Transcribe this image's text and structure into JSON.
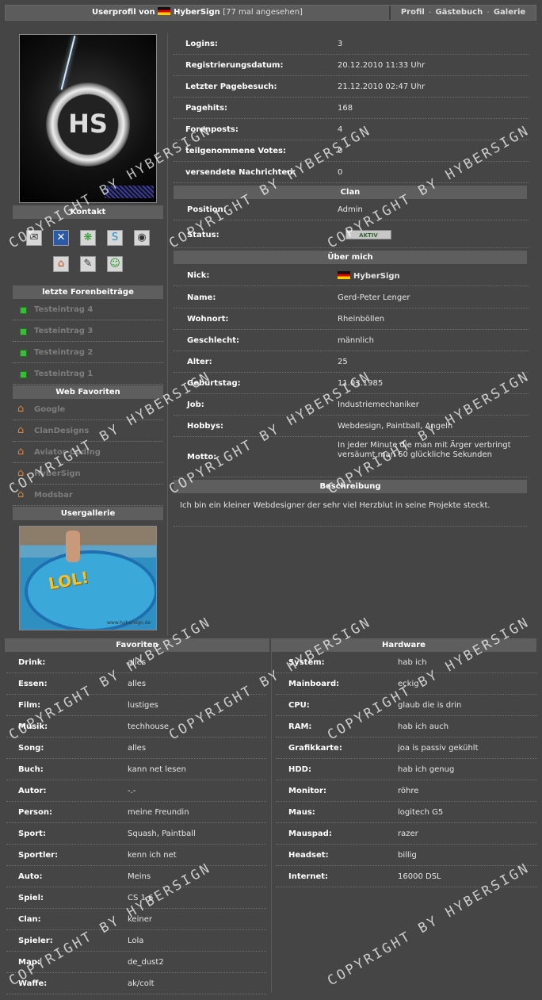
{
  "header": {
    "title_prefix": "Userprofil von",
    "username": "HyberSign",
    "views": "[77 mal angesehen]",
    "nav": [
      "Profil",
      "Gästebuch",
      "Galerie"
    ]
  },
  "sidebar": {
    "contact_title": "Kontakt",
    "contact_icons": [
      "mail-icon",
      "xfire-icon",
      "icq-icon",
      "skype-icon",
      "steam-icon",
      "homepage-icon",
      "guestbook-icon",
      "add-buddy-icon"
    ],
    "posts_title": "letzte Forenbeiträge",
    "posts": [
      "Testeintrag 4",
      "Testeintrag 3",
      "Testeintrag 2",
      "Testeintrag 1"
    ],
    "favorites_title": "Web Favoriten",
    "favorites": [
      "Google",
      "ClanDesigns",
      "Aviator-Coding",
      "HyberSign",
      "Modsbar"
    ],
    "gallery_title": "Usergallerie",
    "gallery_caption": "LOL!"
  },
  "stats": [
    {
      "k": "Logins:",
      "v": "3"
    },
    {
      "k": "Registrierungsdatum:",
      "v": "20.12.2010 11:33 Uhr"
    },
    {
      "k": "Letzter Pagebesuch:",
      "v": "21.12.2010 02:47 Uhr"
    },
    {
      "k": "Pagehits:",
      "v": "168"
    },
    {
      "k": "Forenposts:",
      "v": "4"
    },
    {
      "k": "teilgenommene Votes:",
      "v": "0"
    },
    {
      "k": "versendete Nachrichten:",
      "v": "0"
    }
  ],
  "clan": {
    "title": "Clan",
    "position_label": "Position:",
    "position_value": "Admin",
    "status_label": "Status:",
    "status_badge": "AKTIV"
  },
  "about": {
    "title": "Über mich",
    "rows": [
      {
        "k": "Nick:",
        "v": "HyberSign"
      },
      {
        "k": "Name:",
        "v": "Gerd-Peter Lenger"
      },
      {
        "k": "Wohnort:",
        "v": "Rheinböllen"
      },
      {
        "k": "Geschlecht:",
        "v": "männlich"
      },
      {
        "k": "Alter:",
        "v": "25"
      },
      {
        "k": "Geburtstag:",
        "v": "11.03.1985"
      },
      {
        "k": "Job:",
        "v": "Industriemechaniker"
      },
      {
        "k": "Hobbys:",
        "v": "Webdesign, Paintball, Angeln"
      }
    ],
    "motto_label": "Motto:",
    "motto_value": "In jeder Minute die man mit Ärger verbringt versäumt man 60 glückliche Sekunden"
  },
  "description": {
    "title": "Beschreibung",
    "text": "Ich bin ein kleiner Webdesigner der sehr viel Herzblut in seine Projekte steckt."
  },
  "favorites": {
    "title": "Favoriten",
    "rows": [
      {
        "k": "Drink:",
        "v": "alles"
      },
      {
        "k": "Essen:",
        "v": "alles"
      },
      {
        "k": "Film:",
        "v": "lustiges"
      },
      {
        "k": "Musik:",
        "v": "techhouse"
      },
      {
        "k": "Song:",
        "v": "alles"
      },
      {
        "k": "Buch:",
        "v": "kann net lesen"
      },
      {
        "k": "Autor:",
        "v": "-.-"
      },
      {
        "k": "Person:",
        "v": "meine Freundin"
      },
      {
        "k": "Sport:",
        "v": "Squash, Paintball"
      },
      {
        "k": "Sportler:",
        "v": "kenn ich net"
      },
      {
        "k": "Auto:",
        "v": "Meins"
      },
      {
        "k": "Spiel:",
        "v": "CS 1.6"
      },
      {
        "k": "Clan:",
        "v": "keiner"
      },
      {
        "k": "Spieler:",
        "v": "Lola"
      },
      {
        "k": "Map:",
        "v": "de_dust2"
      },
      {
        "k": "Waffe:",
        "v": "ak/colt"
      }
    ]
  },
  "hardware": {
    "title": "Hardware",
    "rows": [
      {
        "k": "System:",
        "v": "hab ich"
      },
      {
        "k": "Mainboard:",
        "v": "eckig"
      },
      {
        "k": "CPU:",
        "v": "glaub die is drin"
      },
      {
        "k": "RAM:",
        "v": "hab ich auch"
      },
      {
        "k": "Grafikkarte:",
        "v": "joa is passiv gekühlt"
      },
      {
        "k": "HDD:",
        "v": "hab ich genug"
      },
      {
        "k": "Monitor:",
        "v": "röhre"
      },
      {
        "k": "Maus:",
        "v": "logitech G5"
      },
      {
        "k": "Mauspad:",
        "v": "razer"
      },
      {
        "k": "Headset:",
        "v": "billig"
      },
      {
        "k": "Internet:",
        "v": "16000 DSL"
      }
    ]
  },
  "watermark": "COPYRIGHT BY HYBERSIGN"
}
